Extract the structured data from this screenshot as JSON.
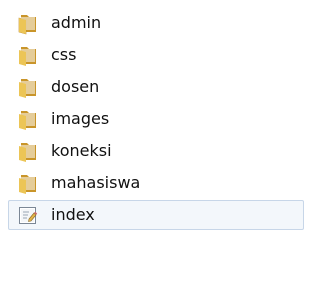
{
  "items": [
    {
      "label": "admin",
      "icon": "folder-icon"
    },
    {
      "label": "css",
      "icon": "folder-icon"
    },
    {
      "label": "dosen",
      "icon": "folder-icon"
    },
    {
      "label": "images",
      "icon": "folder-icon"
    },
    {
      "label": "koneksi",
      "icon": "folder-icon"
    },
    {
      "label": "mahasiswa",
      "icon": "folder-icon"
    },
    {
      "label": "index",
      "icon": "document-icon",
      "selected": true
    }
  ],
  "colors": {
    "folder_front": "#e9bf4f",
    "folder_back": "#c9952a",
    "selection_bg": "#f3f7fb",
    "selection_border": "#c7d6e8"
  }
}
